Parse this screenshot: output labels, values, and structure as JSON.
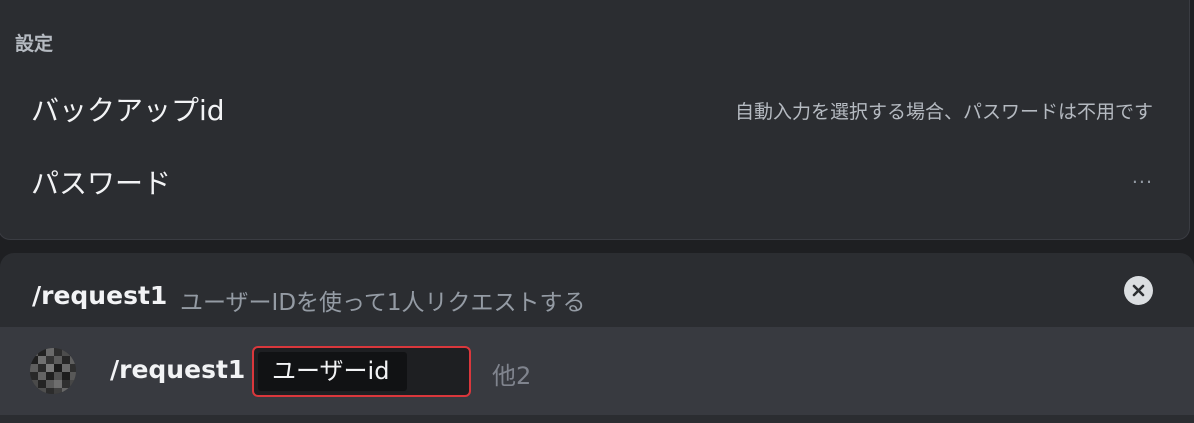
{
  "settings": {
    "title": "設定",
    "options": [
      {
        "label": "バックアップid",
        "description": "自動入力を選択する場合、パスワードは不用です"
      },
      {
        "label": "パスワード",
        "description": "..."
      }
    ]
  },
  "command": {
    "name": "/request1",
    "description": "ユーザーIDを使って1人リクエストする",
    "close_icon": "close-circle-icon"
  },
  "input": {
    "command": "/request1",
    "active_param": "ユーザーid",
    "more_params": "他2",
    "avatar_icon": "user-avatar"
  },
  "colors": {
    "panel_bg": "#2b2d31",
    "input_row_bg": "#383a40",
    "param_border": "#da373c"
  }
}
